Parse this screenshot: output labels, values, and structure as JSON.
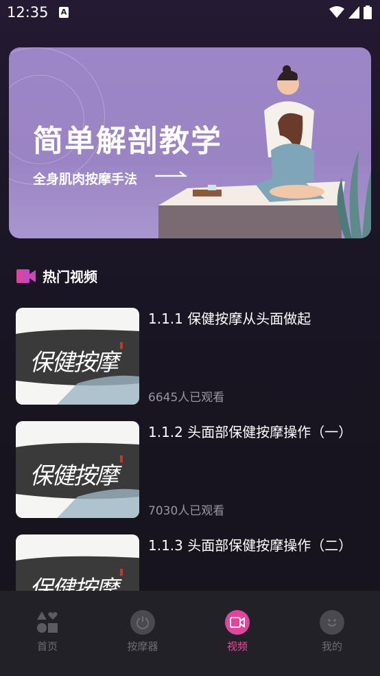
{
  "status_bar": {
    "time": "12:35",
    "notif": "A"
  },
  "banner": {
    "title": "简单解剖教学",
    "subtitle": "全身肌肉按摩手法"
  },
  "section": {
    "title": "热门视频"
  },
  "videos": [
    {
      "title": "1.1.1 保健按摩从头面做起",
      "views": "6645人已观看",
      "thumb_text": "保健按摩"
    },
    {
      "title": "1.1.2 头面部保健按摩操作（一）",
      "views": "7030人已观看",
      "thumb_text": "保健按摩"
    },
    {
      "title": "1.1.3 头面部保健按摩操作（二）",
      "views": "",
      "thumb_text": "保健按摩"
    }
  ],
  "nav": {
    "items": [
      {
        "label": "首页",
        "icon": "shapes-icon"
      },
      {
        "label": "按摩器",
        "icon": "power-icon"
      },
      {
        "label": "视频",
        "icon": "video-camera-icon"
      },
      {
        "label": "我的",
        "icon": "smiley-icon"
      }
    ],
    "active_index": 2
  },
  "colors": {
    "accent": "#e0469e",
    "banner": "#9d86c7",
    "background": "#1c1628"
  }
}
